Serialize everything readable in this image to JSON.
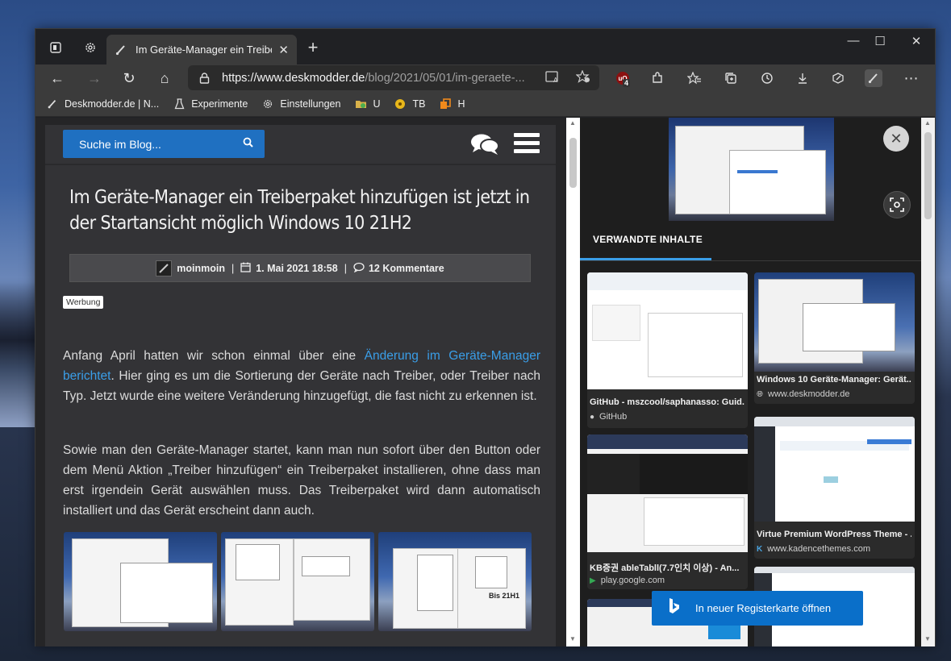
{
  "browser": {
    "tab_title": "Im Geräte-Manager ein Treiberpa",
    "tab_close": "✕",
    "new_tab": "+",
    "window_controls": {
      "minimize": "—",
      "maximize": "☐",
      "close": "✕"
    },
    "nav": {
      "back": "←",
      "forward": "→",
      "refresh": "↻",
      "home": "⌂"
    },
    "url_host": "https://www.deskmodder.de",
    "url_path": "/blog/2021/05/01/im-geraete-...",
    "ublock_badge": "4",
    "bookmarks": [
      {
        "label": "Deskmodder.de | N...",
        "icon": "brush-icon"
      },
      {
        "label": "Experimente",
        "icon": "flask-icon"
      },
      {
        "label": "Einstellungen",
        "icon": "gear-icon"
      },
      {
        "label": "U",
        "icon": "folder-icon"
      },
      {
        "label": "TB",
        "icon": "disc-icon"
      },
      {
        "label": "H",
        "icon": "copy-icon"
      }
    ]
  },
  "page": {
    "search_label": "Suche im Blog...",
    "title": "Im Geräte-Manager ein Treiberpaket hinzufügen ist jetzt in der Startansicht möglich Windows 10 21H2",
    "author": "moinmoin",
    "date": "1. Mai 2021 18:58",
    "comments": "12 Kommentare",
    "ad_label": "Werbung",
    "para1_before": "Anfang April hatten wir schon einmal über eine ",
    "para1_link": "Änderung im Geräte-Manager berichtet",
    "para1_after": ". Hier ging es um die Sortierung der Geräte nach Treiber, oder Treiber nach Typ. Jetzt wurde eine weitere Veränderung hinzugefügt, die fast nicht zu erkennen ist.",
    "para2": "Sowie man den Geräte-Manager startet, kann man nun sofort über den Button oder dem Menü Aktion „Treiber hinzufügen“ ein Treiberpaket installieren, ohne dass man erst irgendein Gerät auswählen muss. Das Treiberpaket wird dann automatisch installiert und das Gerät erscheint dann auch.",
    "thumb3_label": "Bis 21H1"
  },
  "panel": {
    "related_label": "VERWANDTE INHALTE",
    "close": "✕",
    "cards": [
      {
        "title": "GitHub - mszcool/saphanasso: Guid...",
        "source": "GitHub",
        "icon": "github-icon"
      },
      {
        "title": "Windows 10 Geräte-Manager: Gerät...",
        "source": "www.deskmodder.de",
        "icon": "globe-icon"
      },
      {
        "title": "KB증권 ableTabll(7.7인치 이상) - An...",
        "source": "play.google.com",
        "icon": "play-icon"
      },
      {
        "title": "Virtue Premium WordPress Theme - ...",
        "source": "www.kadencethemes.com",
        "icon": "kadence-icon"
      }
    ],
    "open_button": "In neuer Registerkarte öffnen"
  },
  "colors": {
    "accent": "#1f70c1",
    "link": "#3a9ee8",
    "bing_button": "#0a6fc9"
  }
}
